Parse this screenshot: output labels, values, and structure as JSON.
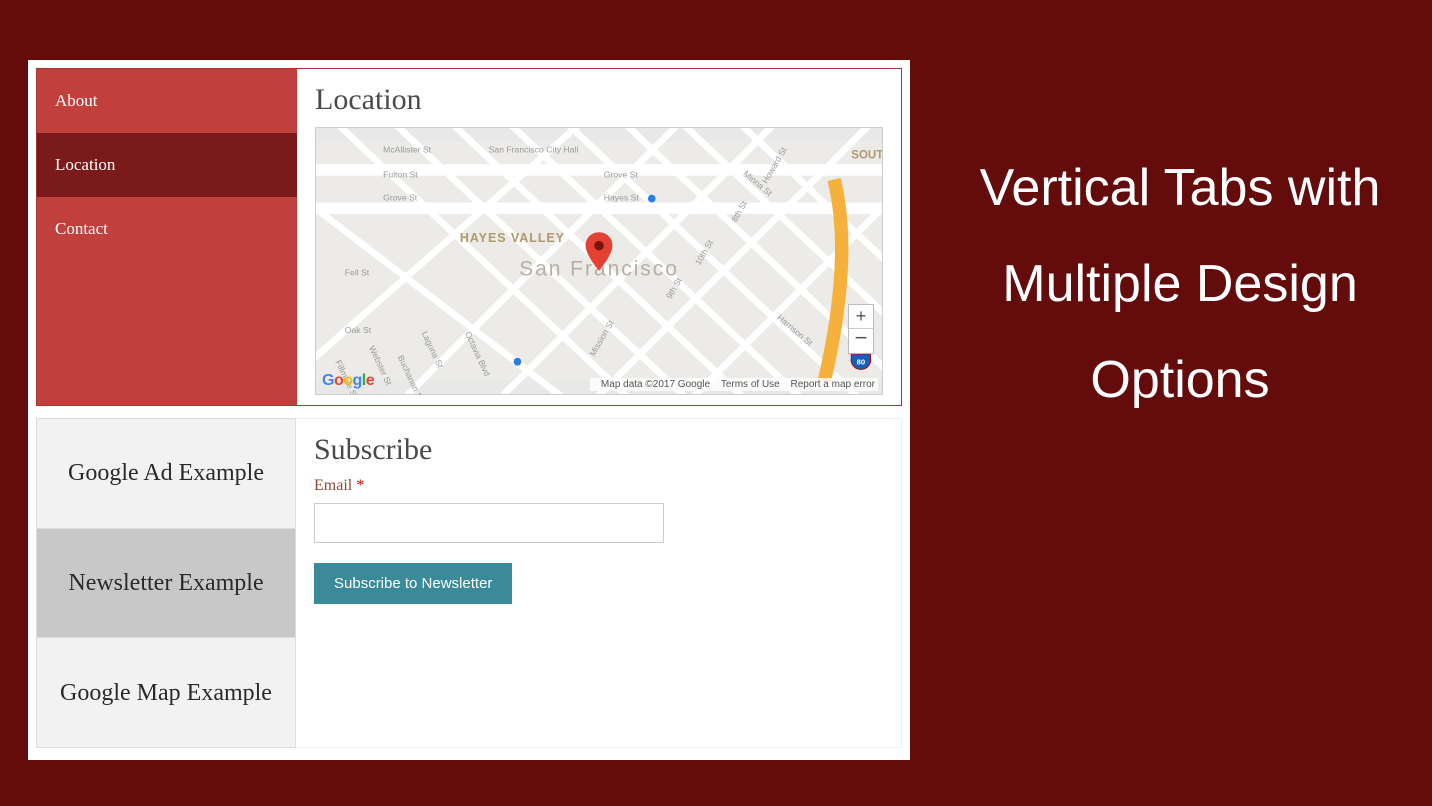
{
  "headline": "Vertical Tabs with Multiple Design Options",
  "redTabs": {
    "items": [
      {
        "label": "About",
        "active": false
      },
      {
        "label": "Location",
        "active": true
      },
      {
        "label": "Contact",
        "active": false
      }
    ]
  },
  "locationPanel": {
    "heading": "Location",
    "map": {
      "city": "San Francisco",
      "district": "HAYES VALLEY",
      "cornerRight": "SOUTH MARK",
      "streets": [
        "McAllister St",
        "San Francisco City Hall",
        "Fulton St",
        "Grove St",
        "Hayes St",
        "Fell St",
        "Oak St",
        "Mission St",
        "9th St",
        "10th St",
        "8th St",
        "Howard St",
        "Minna St",
        "Harrison St",
        "Laguna St",
        "Octavia Blvd",
        "Fillmore St",
        "Webster St",
        "Buchanan St"
      ],
      "logo": "Google",
      "copyright": "Map data ©2017 Google",
      "terms": "Terms of Use",
      "report": "Report a map error",
      "zoomIn": "+",
      "zoomOut": "−",
      "route80": "80"
    }
  },
  "greyTabs": {
    "items": [
      {
        "label": "Google Ad Example",
        "active": false
      },
      {
        "label": "Newsletter Example",
        "active": true
      },
      {
        "label": "Google Map Example",
        "active": false
      }
    ]
  },
  "subscribe": {
    "heading": "Subscribe",
    "emailLabel": "Email",
    "required": "*",
    "emailValue": "",
    "button": "Subscribe to Newsletter"
  }
}
